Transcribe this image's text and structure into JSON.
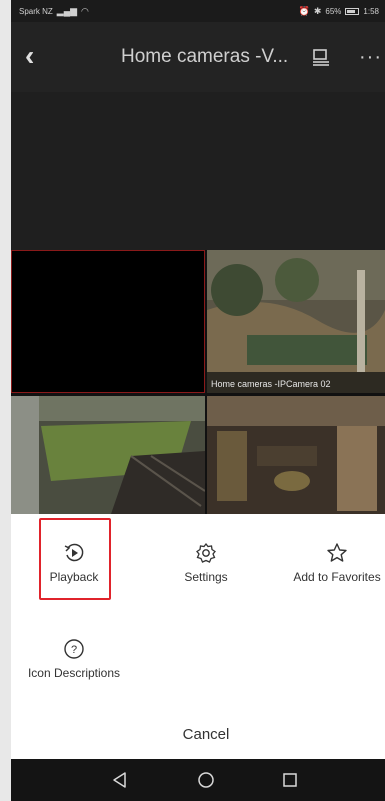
{
  "status_bar": {
    "carrier": "Spark NZ",
    "battery_percent": "65%",
    "time": "1:58"
  },
  "header": {
    "title": "Home cameras -V..."
  },
  "cameras": {
    "tile_2_label": "Home cameras -IPCamera 02"
  },
  "actions": {
    "playback": "Playback",
    "settings": "Settings",
    "add_to_favorites": "Add to Favorites",
    "icon_descriptions": "Icon Descriptions",
    "cancel": "Cancel"
  },
  "colors": {
    "highlight": "#e0232b",
    "sheet_background": "#ffffff",
    "header_background": "#232323"
  },
  "icons": [
    "back-icon",
    "cast-icon",
    "more-icon",
    "playback-icon",
    "settings-icon",
    "star-icon",
    "help-icon",
    "nav-back-icon",
    "nav-home-icon",
    "nav-recent-icon"
  ]
}
